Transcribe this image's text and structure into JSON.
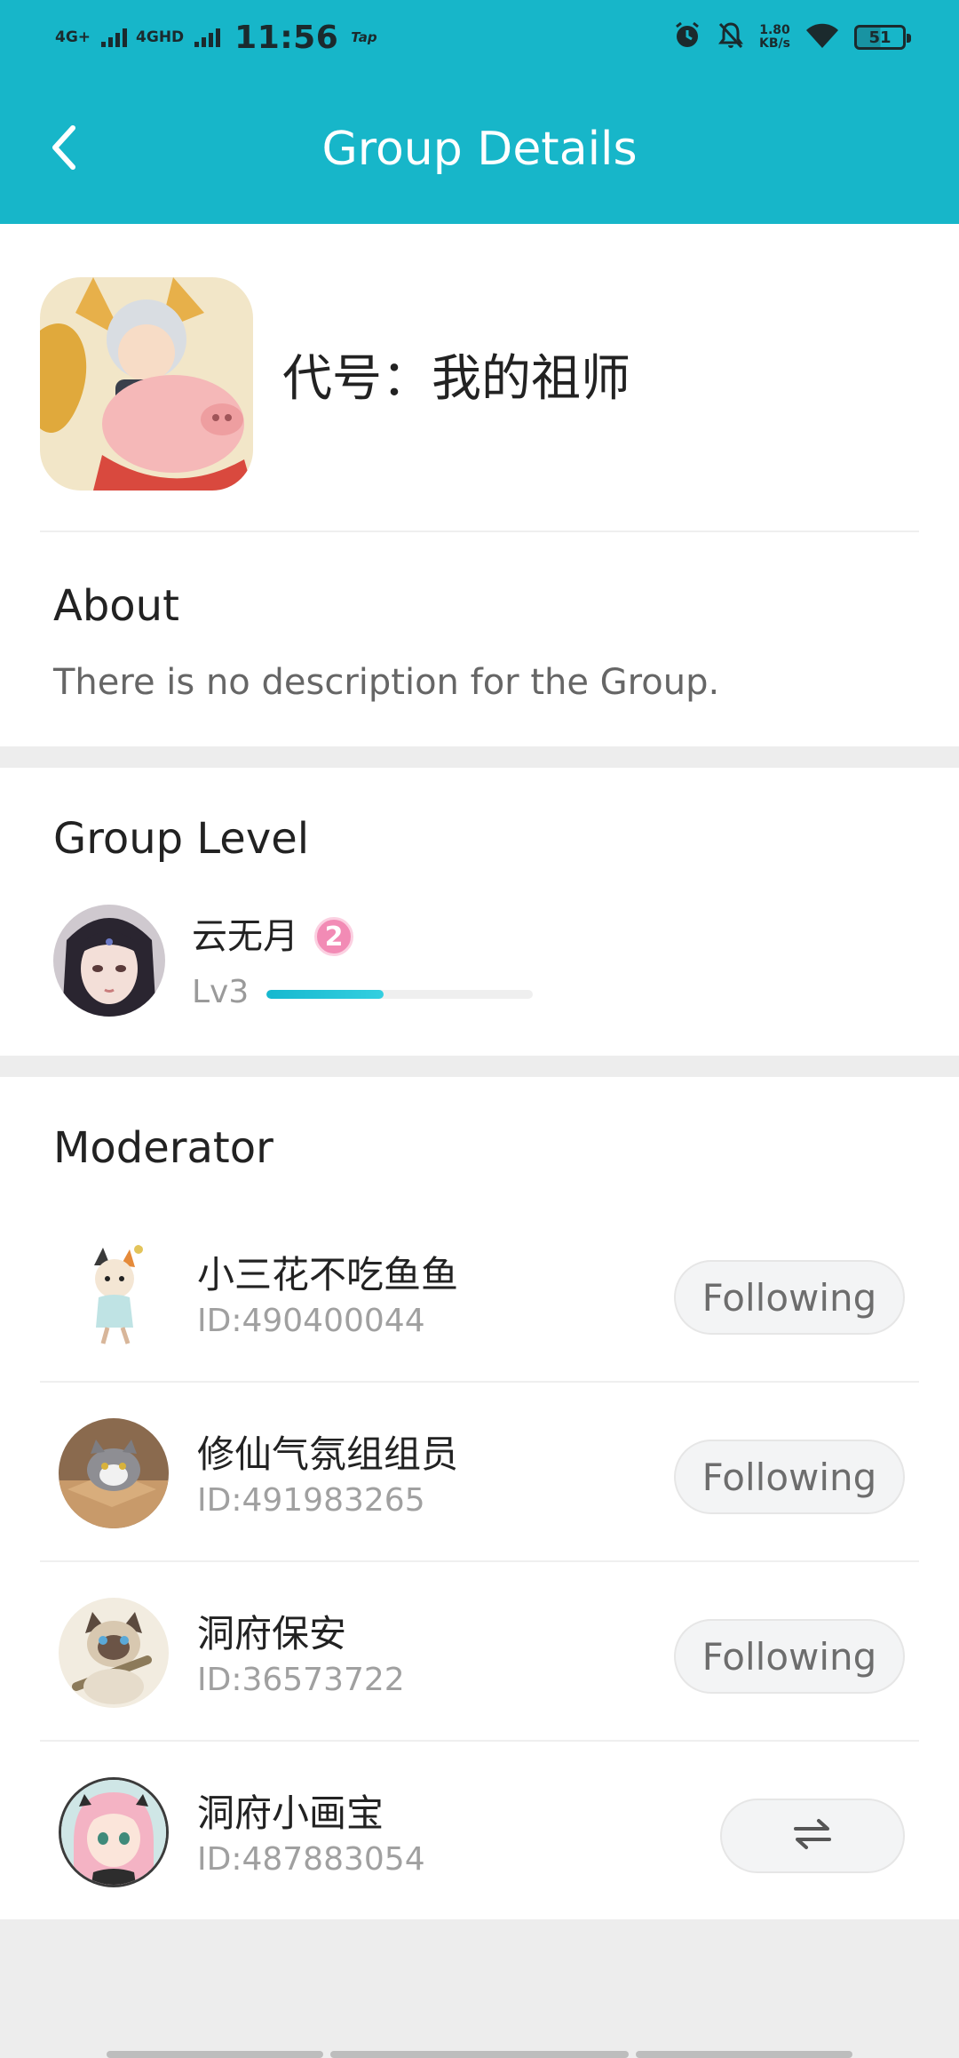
{
  "status_bar": {
    "network_1": "4G+",
    "network_2": "4GHD",
    "time": "11:56",
    "app_indicator": "Tap",
    "speed_value": "1.80",
    "speed_unit": "KB/s",
    "battery": "51",
    "icons": [
      "alarm-icon",
      "bell-off-icon",
      "wifi-icon",
      "battery-icon"
    ]
  },
  "header": {
    "title": "Group Details",
    "back_icon": "chevron-left-icon",
    "background_color": "#17b6c9"
  },
  "group": {
    "name": "代号：我的祖师",
    "icon": "group-app-icon"
  },
  "about": {
    "title": "About",
    "text": "There is no description for the Group."
  },
  "group_level": {
    "title": "Group Level",
    "user_name": "云无月",
    "badge": "2",
    "level_label": "Lv3",
    "progress_fraction": 0.44
  },
  "moderator": {
    "title": "Moderator",
    "items": [
      {
        "name": "小三花不吃鱼鱼",
        "id": "ID:490400044",
        "action": "Following"
      },
      {
        "name": "修仙气氛组组员",
        "id": "ID:491983265",
        "action": "Following"
      },
      {
        "name": "洞府保安",
        "id": "ID:36573722",
        "action": "Following"
      },
      {
        "name": "洞府小画宝",
        "id": "ID:487883054",
        "action_icon": "swap-arrows-icon"
      }
    ]
  },
  "colors": {
    "accent": "#17b6c9",
    "badge_pink": "#f28bb5",
    "page_bg": "#ededed"
  }
}
